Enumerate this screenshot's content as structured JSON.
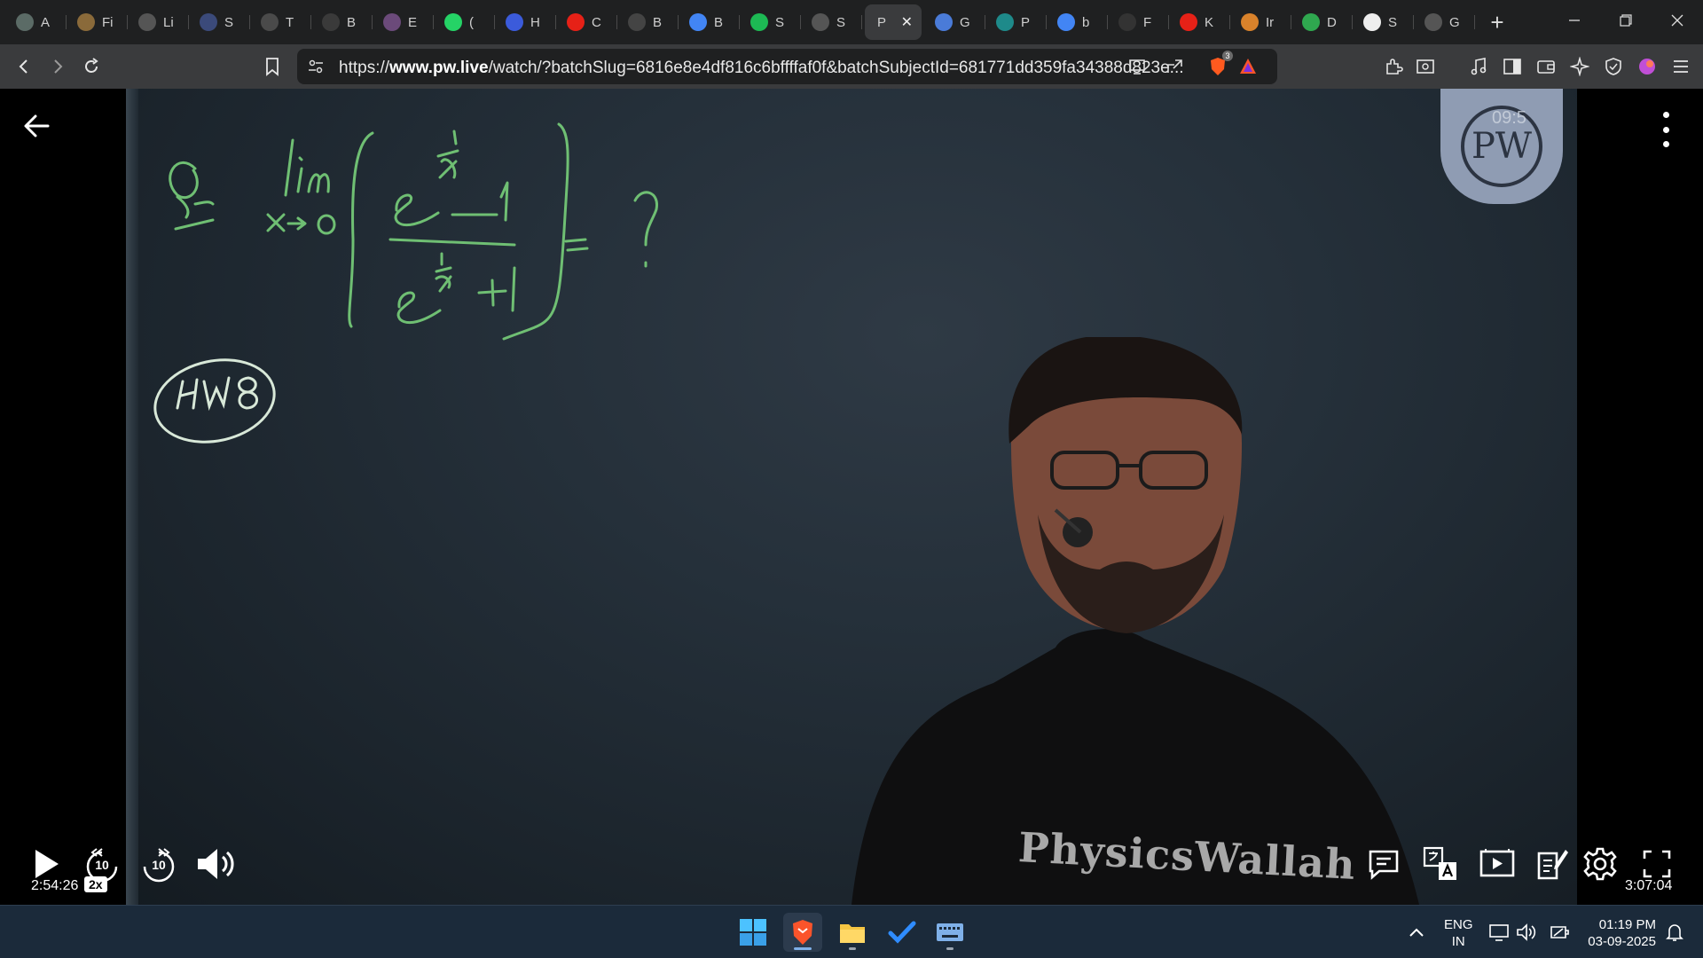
{
  "browser": {
    "tabs": [
      {
        "label": "A",
        "favicon": "chatgpt-icon",
        "color": "#5b6b66"
      },
      {
        "label": "Fi",
        "favicon": "openai-icon",
        "color": "#8a6a3a"
      },
      {
        "label": "Li",
        "favicon": "globe-icon",
        "color": "#555"
      },
      {
        "label": "S",
        "favicon": "dots-icon",
        "color": "#3b4a7a"
      },
      {
        "label": "T",
        "favicon": "wolfram-icon",
        "color": "#4a4a4a"
      },
      {
        "label": "B",
        "favicon": "menu-icon",
        "color": "#3a3a3a"
      },
      {
        "label": "E",
        "favicon": "grid-icon",
        "color": "#6b4a7a"
      },
      {
        "label": "(",
        "favicon": "whatsapp-icon",
        "color": "#25d366"
      },
      {
        "label": "H",
        "favicon": "bookmark-icon",
        "color": "#3b5bdb"
      },
      {
        "label": "C",
        "favicon": "youtube-icon",
        "color": "#e62117"
      },
      {
        "label": "B",
        "favicon": "circle-text-icon",
        "color": "#444"
      },
      {
        "label": "B",
        "favicon": "google-icon",
        "color": "#4285f4"
      },
      {
        "label": "S",
        "favicon": "spotify-icon",
        "color": "#1db954"
      },
      {
        "label": "S",
        "favicon": "globe-icon",
        "color": "#555"
      }
    ],
    "active_tab": {
      "label": "P",
      "close": "✕"
    },
    "tabs_after": [
      {
        "label": "G",
        "favicon": "gemini-icon",
        "color": "#4a7bd8"
      },
      {
        "label": "P",
        "favicon": "perplexity-icon",
        "color": "#1e8a8a"
      },
      {
        "label": "b",
        "favicon": "google-icon",
        "color": "#4285f4"
      },
      {
        "label": "F",
        "favicon": "screen-icon",
        "color": "#333"
      },
      {
        "label": "K",
        "favicon": "youtube-icon",
        "color": "#e62117"
      },
      {
        "label": "Ir",
        "favicon": "burger-icon",
        "color": "#d9822b"
      },
      {
        "label": "D",
        "favicon": "leaf-icon",
        "color": "#2fa84f"
      },
      {
        "label": "S",
        "favicon": "wikipedia-icon",
        "color": "#eee"
      },
      {
        "label": "G",
        "favicon": "globe-icon",
        "color": "#555"
      }
    ],
    "new_tab": "+",
    "url_prefix": "https://",
    "url_domain": "www.pw.live",
    "url_rest": "/watch/?batchSlug=6816e8e4df816c6bffffaf0f&batchSubjectId=681771dd359fa34388d823e...",
    "brave_badge": "3"
  },
  "player": {
    "time_current": "2:54:26",
    "speed": "2x",
    "time_total": "3:07:04",
    "progress_fraction": 0.933,
    "logo_time": "09:5",
    "watermark": "PhysicsWallah",
    "rewind_label": "10",
    "forward_label": "10"
  },
  "board": {
    "q_mark": "Q.",
    "lim": "lim",
    "lim_sub": "x→0",
    "numerator": "e^(1/x) − 1",
    "denominator": "e^(1/x) + 1",
    "equals": "= ?",
    "tag": "HW8",
    "ink_color": "#6fbf73"
  },
  "taskbar": {
    "lang_line1": "ENG",
    "lang_line2": "IN",
    "time": "01:19 PM",
    "date": "03-09-2025"
  }
}
